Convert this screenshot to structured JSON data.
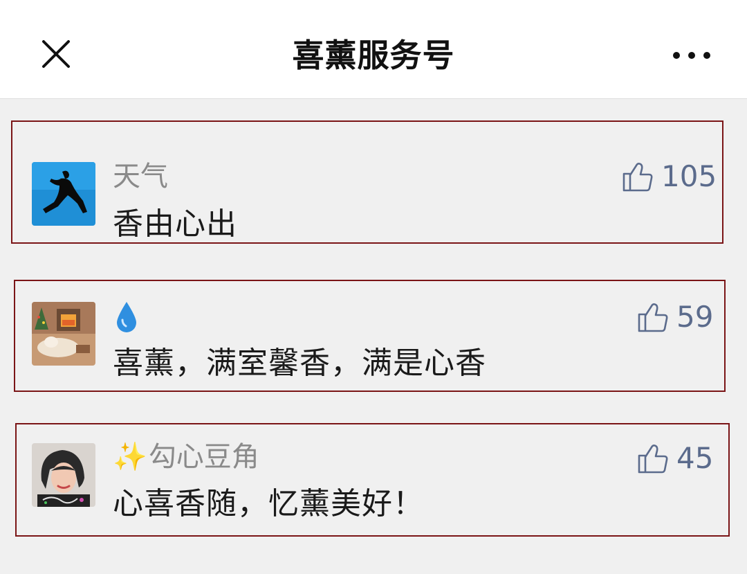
{
  "header": {
    "title": "喜薰服务号",
    "close_icon": "close-icon",
    "more_icon": "more-icon"
  },
  "comments": [
    {
      "username": "天气",
      "text": "香由心出",
      "likes": "105",
      "avatar": "silhouette-jump-avatar"
    },
    {
      "username_emoji": "droplet-emoji",
      "text": "喜薰，满室馨香，满是心香",
      "likes": "59",
      "avatar": "cozy-room-avatar"
    },
    {
      "username_emoji": "✨",
      "username": "勾心豆角",
      "text": "心喜香随，忆薰美好！",
      "likes": "45",
      "avatar": "woman-portrait-avatar"
    }
  ],
  "colors": {
    "like_blue": "#5b6b8c",
    "highlight_border": "#7a1416",
    "background": "#f0f0f0"
  }
}
